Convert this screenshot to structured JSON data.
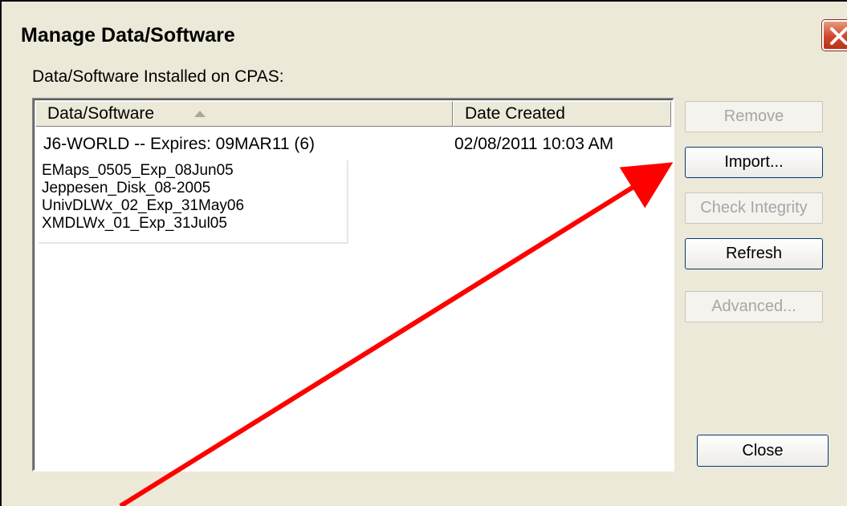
{
  "window": {
    "title": "Manage Data/Software",
    "close_icon": "close-x-icon"
  },
  "group_label": "Data/Software Installed on CPAS:",
  "list": {
    "columns": [
      "Data/Software",
      "Date Created"
    ],
    "sort_column": "Data/Software",
    "sort_direction": "ascending",
    "rows": [
      {
        "name": "J6-WORLD -- Expires: 09MAR11 (6)",
        "date": "02/08/2011 10:03 AM"
      }
    ]
  },
  "popup_list": {
    "items": [
      "EMaps_0505_Exp_08Jun05",
      "Jeppesen_Disk_08-2005",
      "UnivDLWx_02_Exp_31May06",
      "XMDLWx_01_Exp_31Jul05"
    ]
  },
  "buttons": {
    "remove": {
      "label": "Remove",
      "enabled": false
    },
    "import": {
      "label": "Import...",
      "enabled": true
    },
    "check_integrity": {
      "label": "Check Integrity",
      "enabled": false
    },
    "refresh": {
      "label": "Refresh",
      "enabled": true
    },
    "advanced": {
      "label": "Advanced...",
      "enabled": false
    },
    "close": {
      "label": "Close",
      "enabled": true
    }
  },
  "annotation": {
    "color": "#ff0000",
    "points_to": "import"
  },
  "colors": {
    "dialog_bg": "#ece9d8",
    "close_button": "#d0462c",
    "disabled_text": "#a6a6a6"
  }
}
